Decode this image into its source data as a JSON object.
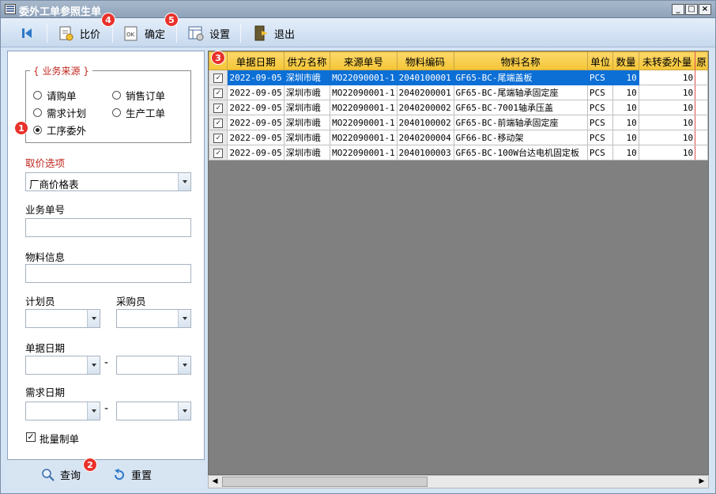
{
  "window": {
    "title": "委外工单参照生单",
    "controls": [
      "_",
      "□",
      "×"
    ]
  },
  "toolbar": {
    "first_icon": "first-record-icon",
    "compare_label": "比价",
    "confirm_label": "确定",
    "settings_label": "设置",
    "exit_label": "退出"
  },
  "badges": {
    "b1": "1",
    "b2": "2",
    "b3": "3",
    "b4": "4",
    "b5": "5"
  },
  "filter": {
    "group_title": "{ 业务来源 }",
    "sources": [
      "请购单",
      "销售订单",
      "需求计划",
      "生产工单",
      "工序委外"
    ],
    "selected_source": "工序委外",
    "price_option_label": "取价选项",
    "price_option_value": "厂商价格表",
    "order_no_label": "业务单号",
    "material_label": "物料信息",
    "planner_label": "计划员",
    "buyer_label": "采购员",
    "doc_date_label": "单据日期",
    "demand_date_label": "需求日期",
    "range_sep": "-",
    "batch_label": "批量制单",
    "batch_checked": "✓"
  },
  "bottom": {
    "query_label": "查询",
    "reset_label": "重置"
  },
  "grid": {
    "columns": [
      "单据日期",
      "供方名称",
      "来源单号",
      "物料编码",
      "物料名称",
      "单位",
      "数量",
      "未转委外量",
      "原"
    ],
    "rows": [
      [
        "2022-09-05",
        "深圳市峨",
        "MO22090001-1",
        "2040100001",
        "GF65-BC-尾端盖板",
        "PCS",
        "10",
        "10",
        ""
      ],
      [
        "2022-09-05",
        "深圳市峨",
        "MO22090001-1",
        "2040200001",
        "GF65-BC-尾端轴承固定座",
        "PCS",
        "10",
        "10",
        ""
      ],
      [
        "2022-09-05",
        "深圳市峨",
        "MO22090001-1",
        "2040200002",
        "GF65-BC-7001轴承压盖",
        "PCS",
        "10",
        "10",
        ""
      ],
      [
        "2022-09-05",
        "深圳市峨",
        "MO22090001-1",
        "2040100002",
        "GF65-BC-前端轴承固定座",
        "PCS",
        "10",
        "10",
        ""
      ],
      [
        "2022-09-05",
        "深圳市峨",
        "MO22090001-1",
        "2040200004",
        "GF66-BC-移动架",
        "PCS",
        "10",
        "10",
        ""
      ],
      [
        "2022-09-05",
        "深圳市峨",
        "MO22090001-1",
        "2040100003",
        "GF65-BC-100W台达电机固定板",
        "PCS",
        "10",
        "10",
        ""
      ]
    ],
    "check_mark": "✓"
  },
  "scroll": {
    "left": "◀",
    "right": "▶"
  }
}
